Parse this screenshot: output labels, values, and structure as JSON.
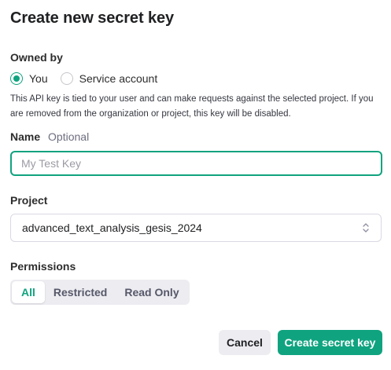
{
  "dialog": {
    "title": "Create new secret key"
  },
  "owned_by": {
    "label": "Owned by",
    "options": [
      {
        "label": "You",
        "selected": true
      },
      {
        "label": "Service account",
        "selected": false
      }
    ],
    "help_text": "This API key is tied to your user and can make requests against the selected project. If you are removed from the organization or project, this key will be disabled."
  },
  "name": {
    "label": "Name",
    "optional": "Optional",
    "value": "",
    "placeholder": "My Test Key"
  },
  "project": {
    "label": "Project",
    "selected": "advanced_text_analysis_gesis_2024"
  },
  "permissions": {
    "label": "Permissions",
    "options": [
      "All",
      "Restricted",
      "Read Only"
    ],
    "selected": "All"
  },
  "actions": {
    "cancel_label": "Cancel",
    "create_label": "Create secret key"
  },
  "colors": {
    "accent": "#10a37f",
    "muted_bg": "#ececf1",
    "border": "#d9d9e3"
  }
}
